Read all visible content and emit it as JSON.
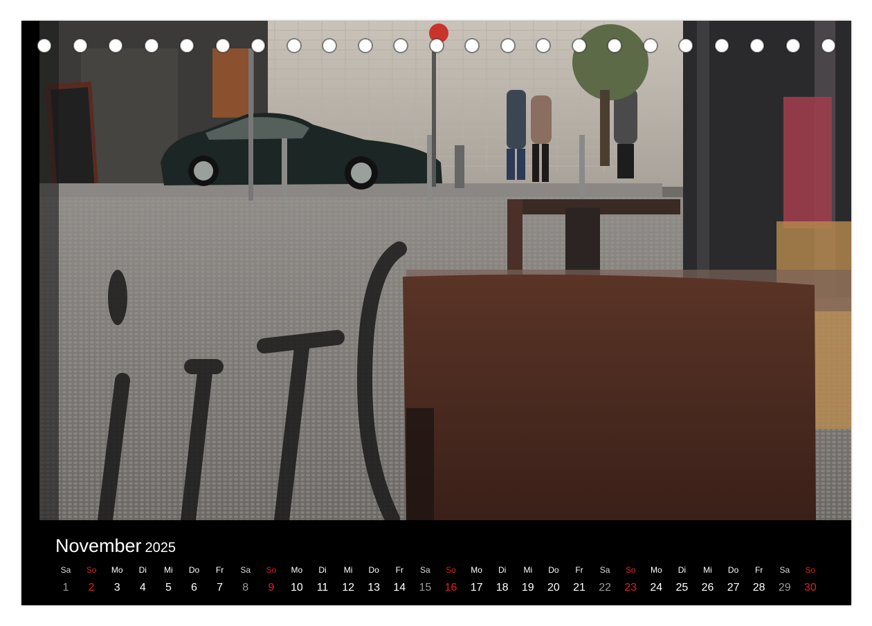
{
  "calendar": {
    "month": "November",
    "year": "2025",
    "days": [
      {
        "wd": "Sa",
        "num": "1",
        "kind": "sat"
      },
      {
        "wd": "So",
        "num": "2",
        "kind": "sun"
      },
      {
        "wd": "Mo",
        "num": "3",
        "kind": "week"
      },
      {
        "wd": "Di",
        "num": "4",
        "kind": "week"
      },
      {
        "wd": "Mi",
        "num": "5",
        "kind": "week"
      },
      {
        "wd": "Do",
        "num": "6",
        "kind": "week"
      },
      {
        "wd": "Fr",
        "num": "7",
        "kind": "week"
      },
      {
        "wd": "Sa",
        "num": "8",
        "kind": "sat"
      },
      {
        "wd": "So",
        "num": "9",
        "kind": "sun"
      },
      {
        "wd": "Mo",
        "num": "10",
        "kind": "week"
      },
      {
        "wd": "Di",
        "num": "11",
        "kind": "week"
      },
      {
        "wd": "Mi",
        "num": "12",
        "kind": "week"
      },
      {
        "wd": "Do",
        "num": "13",
        "kind": "week"
      },
      {
        "wd": "Fr",
        "num": "14",
        "kind": "week"
      },
      {
        "wd": "Sa",
        "num": "15",
        "kind": "sat"
      },
      {
        "wd": "So",
        "num": "16",
        "kind": "sun"
      },
      {
        "wd": "Mo",
        "num": "17",
        "kind": "week"
      },
      {
        "wd": "Di",
        "num": "18",
        "kind": "week"
      },
      {
        "wd": "Mi",
        "num": "19",
        "kind": "week"
      },
      {
        "wd": "Do",
        "num": "20",
        "kind": "week"
      },
      {
        "wd": "Fr",
        "num": "21",
        "kind": "week"
      },
      {
        "wd": "Sa",
        "num": "22",
        "kind": "sat"
      },
      {
        "wd": "So",
        "num": "23",
        "kind": "sun"
      },
      {
        "wd": "Mo",
        "num": "24",
        "kind": "week"
      },
      {
        "wd": "Di",
        "num": "25",
        "kind": "week"
      },
      {
        "wd": "Mi",
        "num": "26",
        "kind": "week"
      },
      {
        "wd": "Do",
        "num": "27",
        "kind": "week"
      },
      {
        "wd": "Fr",
        "num": "28",
        "kind": "week"
      },
      {
        "wd": "Sa",
        "num": "29",
        "kind": "sat"
      },
      {
        "wd": "So",
        "num": "30",
        "kind": "sun"
      }
    ]
  },
  "colors": {
    "background": "#000000",
    "weekday_text": "#ffffff",
    "saturday_text": "#9a9a9a",
    "sunday_text": "#e02020"
  }
}
